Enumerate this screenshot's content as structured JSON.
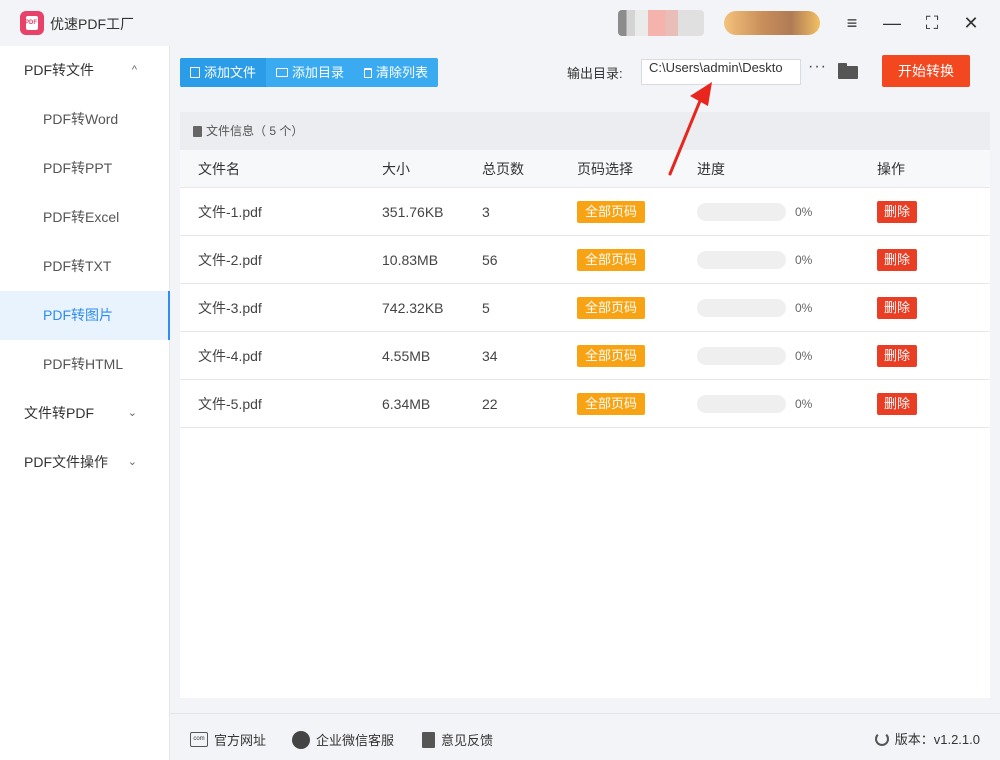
{
  "app": {
    "title": "优速PDF工厂",
    "logo_text": "PDF"
  },
  "window": {
    "menu_icon": "≡",
    "minimize_icon": "—",
    "maximize_icon": "⛶",
    "close_icon": "✕"
  },
  "sidebar": {
    "groups": [
      {
        "label": "PDF转文件",
        "chevron": "^"
      },
      {
        "label": "文件转PDF",
        "chevron": "⌄"
      },
      {
        "label": "PDF文件操作",
        "chevron": "⌄"
      }
    ],
    "items": [
      {
        "label": "PDF转Word"
      },
      {
        "label": "PDF转PPT"
      },
      {
        "label": "PDF转Excel"
      },
      {
        "label": "PDF转TXT"
      },
      {
        "label": "PDF转图片"
      },
      {
        "label": "PDF转HTML"
      }
    ],
    "active_item": "PDF转图片"
  },
  "toolbar": {
    "add_file": "添加文件",
    "add_folder": "添加目录",
    "clear_list": "清除列表",
    "output_label": "输出目录:",
    "output_path": "C:\\Users\\admin\\Deskto",
    "more": "···",
    "start": "开始转换"
  },
  "panel": {
    "header": "文件信息（ 5 个）",
    "columns": [
      "文件名",
      "大小",
      "总页数",
      "页码选择",
      "进度",
      "操作"
    ],
    "rows": [
      {
        "name": "文件-1.pdf",
        "size": "351.76KB",
        "pages": "3",
        "range": "全部页码",
        "progress": "0%",
        "action": "删除"
      },
      {
        "name": "文件-2.pdf",
        "size": "10.83MB",
        "pages": "56",
        "range": "全部页码",
        "progress": "0%",
        "action": "删除"
      },
      {
        "name": "文件-3.pdf",
        "size": "742.32KB",
        "pages": "5",
        "range": "全部页码",
        "progress": "0%",
        "action": "删除"
      },
      {
        "name": "文件-4.pdf",
        "size": "4.55MB",
        "pages": "34",
        "range": "全部页码",
        "progress": "0%",
        "action": "删除"
      },
      {
        "name": "文件-5.pdf",
        "size": "6.34MB",
        "pages": "22",
        "range": "全部页码",
        "progress": "0%",
        "action": "删除"
      }
    ]
  },
  "footer": {
    "website": "官方网址",
    "wechat": "企业微信客服",
    "feedback": "意见反馈",
    "version": "版本：v1.2.1.0",
    "com_label": "com"
  },
  "colors": {
    "accent_blue": "#2f8cf0",
    "toolbar_blue": "#3aabf0",
    "start_red": "#f2471f",
    "pill_orange": "#f7a313",
    "delete_red": "#e93e24",
    "arrow_red": "#e8261d"
  }
}
